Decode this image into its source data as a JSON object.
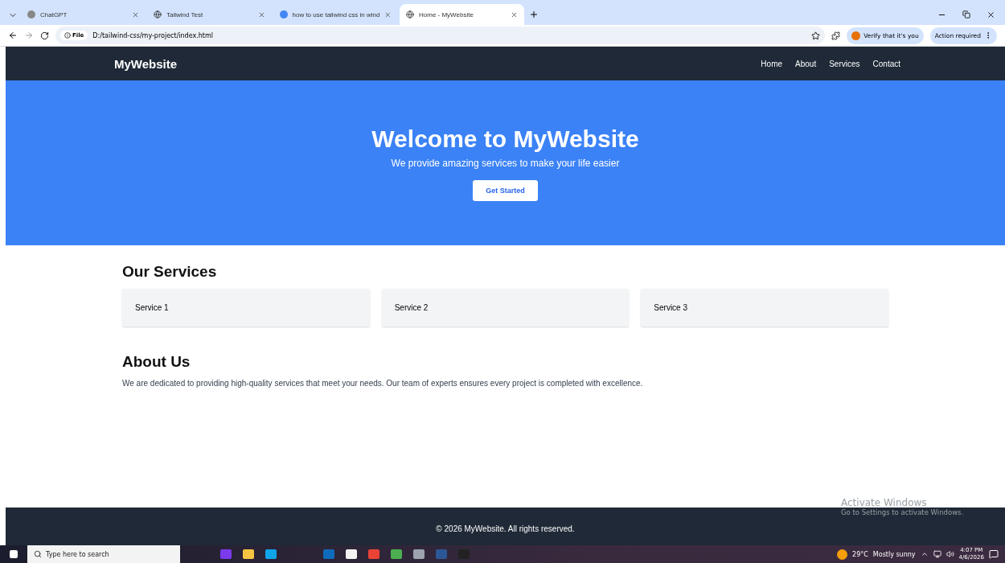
{
  "browser": {
    "tabs": [
      {
        "title": "ChatGPT",
        "selected": false,
        "kind": "dot"
      },
      {
        "title": "Tailwind Test",
        "selected": false,
        "kind": "globe"
      },
      {
        "title": "how to use tailwind css in wind",
        "selected": false,
        "kind": "google"
      },
      {
        "title": "Home - MyWebsite",
        "selected": true,
        "kind": "globe"
      }
    ],
    "address_badge": "File",
    "url": "D:/tailwind-css/my-project/index.html",
    "profile_button": "Verify that it's you",
    "action_button": "Action required"
  },
  "site": {
    "brand": "MyWebsite",
    "nav": [
      "Home",
      "About",
      "Services",
      "Contact"
    ],
    "hero": {
      "title": "Welcome to MyWebsite",
      "subtitle": "We provide amazing services to make your life easier",
      "button": "Get Started"
    },
    "services": {
      "heading": "Our Services",
      "cards": [
        "Service 1",
        "Service 2",
        "Service 3"
      ]
    },
    "about": {
      "heading": "About Us",
      "text": "We are dedicated to providing high-quality services that meet your needs. Our team of experts ensures every project is completed with excellence."
    },
    "footer": "© 2026 MyWebsite. All rights reserved."
  },
  "activation": {
    "title": "Activate Windows",
    "hint": "Go to Settings to activate Windows."
  },
  "taskbar": {
    "search_placeholder": "Type here to search",
    "weather": "29°C",
    "weather_text": "Mostly sunny",
    "time": "4:07 PM",
    "date": "4/6/2026"
  }
}
